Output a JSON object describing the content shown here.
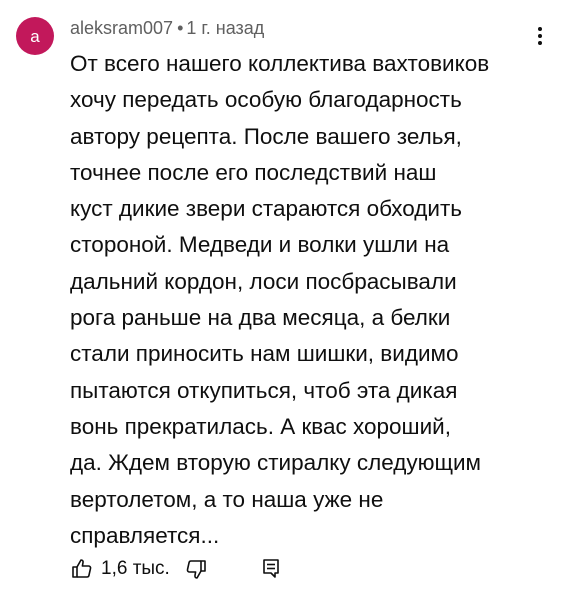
{
  "comment": {
    "avatar_letter": "a",
    "avatar_color": "#c2185b",
    "author": "aleksram007",
    "separator": "•",
    "time": "1 г. назад",
    "text_lines": [
      "От всего нашего коллектива вахтовиков",
      "хочу передать особую благодарность",
      "автору рецепта. После вашего зелья,",
      "точнее после его последствий наш",
      "куст дикие звери стараются обходить",
      "стороной. Медведи и волки ушли на",
      "дальний кордон, лоси посбрасывали",
      "рога раньше на два месяца, а белки",
      "стали приносить нам шишки, видимо",
      "пытаются откупиться, чтоб эта дикая",
      "вонь прекратилась. А квас хороший,",
      "да. Ждем вторую стиралку следующим",
      "вертолетом, а то наша уже не",
      "справляется..."
    ],
    "like_count": "1,6 тыс.",
    "icons": {
      "menu": "more-vertical-icon",
      "like": "thumbs-up-icon",
      "dislike": "thumbs-down-icon",
      "reply": "reply-comment-icon"
    }
  }
}
